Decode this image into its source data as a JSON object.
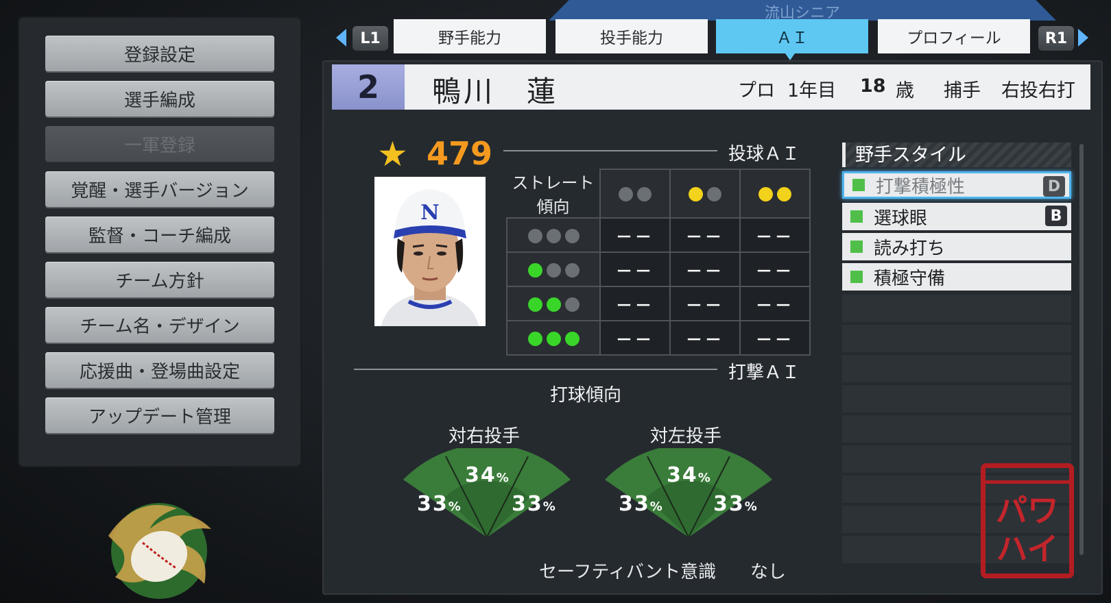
{
  "menu": {
    "items": [
      {
        "label": "登録設定",
        "enabled": true
      },
      {
        "label": "選手編成",
        "enabled": true
      },
      {
        "label": "一軍登録",
        "enabled": false
      },
      {
        "label": "覚醒・選手バージョン",
        "enabled": true
      },
      {
        "label": "監督・コーチ編成",
        "enabled": true
      },
      {
        "label": "チーム方針",
        "enabled": true
      },
      {
        "label": "チーム名・デザイン",
        "enabled": true
      },
      {
        "label": "応援曲・登場曲設定",
        "enabled": true
      },
      {
        "label": "アップデート管理",
        "enabled": true
      }
    ]
  },
  "header": {
    "team_name": "流山シニア",
    "left_shoulder": "L1",
    "right_shoulder": "R1",
    "tabs": [
      {
        "label": "野手能力",
        "active": false
      },
      {
        "label": "投手能力",
        "active": false
      },
      {
        "label": "ＡＩ",
        "active": true
      },
      {
        "label": "プロフィール",
        "active": false
      }
    ]
  },
  "player": {
    "number": "2",
    "name": "鴨川　蓮",
    "class": "プロ",
    "year": "1年目",
    "age": "18",
    "age_unit": "歳",
    "position": "捕手",
    "throw_bat": "右投右打",
    "rating": "479"
  },
  "pitching_ai": {
    "title": "投球ＡＩ",
    "corner_label": "ストレート傾向",
    "columns": [
      {
        "dots": [
          "gray",
          "gray"
        ]
      },
      {
        "dots": [
          "yellow",
          "gray"
        ]
      },
      {
        "dots": [
          "yellow",
          "yellow"
        ]
      }
    ],
    "rows": [
      {
        "dots": [
          "gray",
          "gray",
          "gray"
        ],
        "cells": [
          "－－",
          "－－",
          "－－"
        ]
      },
      {
        "dots": [
          "green",
          "gray",
          "gray"
        ],
        "cells": [
          "－－",
          "－－",
          "－－"
        ]
      },
      {
        "dots": [
          "green",
          "green",
          "gray"
        ],
        "cells": [
          "－－",
          "－－",
          "－－"
        ]
      },
      {
        "dots": [
          "green",
          "green",
          "green"
        ],
        "cells": [
          "－－",
          "－－",
          "－－"
        ]
      }
    ]
  },
  "batting_ai": {
    "title": "打撃ＡＩ",
    "subtitle": "打球傾向",
    "vs_right": {
      "label": "対右投手",
      "left": "33",
      "center": "34",
      "right": "33",
      "unit": "%"
    },
    "vs_left": {
      "label": "対左投手",
      "left": "33",
      "center": "34",
      "right": "33",
      "unit": "%"
    },
    "bunt_label": "セーフティバント意識",
    "bunt_value": "なし"
  },
  "fielder_style": {
    "title": "野手スタイル",
    "items": [
      {
        "label": "打撃積極性",
        "grade": "D",
        "selected": true
      },
      {
        "label": "選球眼",
        "grade": "B",
        "selected": false
      },
      {
        "label": "読み打ち",
        "grade": "",
        "selected": false
      },
      {
        "label": "積極守備",
        "grade": "",
        "selected": false
      }
    ],
    "empty_slots": 9
  },
  "stamp_text": [
    "パワ",
    "ハイ"
  ],
  "colors": {
    "accent": "#5ec8f3",
    "rating": "#f59a1f",
    "star": "#f4c020",
    "dot_gray": "#6b7075",
    "dot_yellow": "#f2d21b",
    "dot_green": "#39d629",
    "fan_green": "#3a7c3a",
    "stamp": "#b31d22"
  }
}
